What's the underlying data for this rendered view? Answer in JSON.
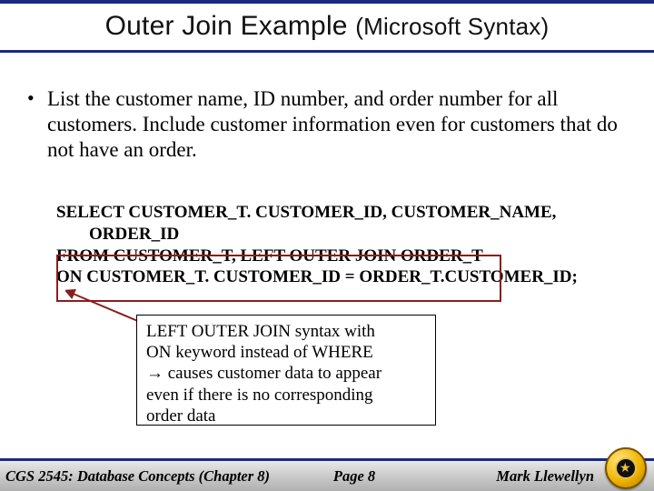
{
  "title": {
    "main": "Outer Join Example",
    "subtitle": "(Microsoft Syntax)"
  },
  "bullet": {
    "text": "List the customer name, ID number, and order number for all customers. Include customer information even for customers that do not have an order."
  },
  "sql": {
    "line1": "SELECT CUSTOMER_T. CUSTOMER_ID, CUSTOMER_NAME,",
    "line2": "ORDER_ID",
    "line3": "FROM CUSTOMER_T, LEFT OUTER JOIN ORDER_T",
    "line4": "ON CUSTOMER_T. CUSTOMER_ID = ORDER_T.CUSTOMER_ID;"
  },
  "callout": {
    "line1": "LEFT OUTER JOIN syntax with",
    "line2": "ON keyword instead of WHERE",
    "line3_prefix": "→",
    "line3_rest": " causes customer data to appear",
    "line4": "even if there is no corresponding",
    "line5": "order data"
  },
  "footer": {
    "left": "CGS 2545: Database Concepts  (Chapter 8)",
    "center": "Page 8",
    "right": "Mark Llewellyn"
  },
  "glyphs": {
    "bullet": "•"
  },
  "colors": {
    "accent": "#1a2a80",
    "highlight_border": "#8a1d1d"
  }
}
